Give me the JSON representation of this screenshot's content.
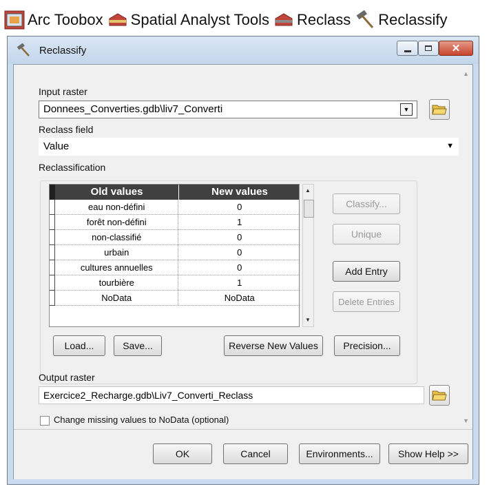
{
  "breadcrumb": {
    "items": [
      {
        "label": "Arc Toobox",
        "icon": "toolbox-icon"
      },
      {
        "label": "Spatial Analyst Tools",
        "icon": "toolset-icon"
      },
      {
        "label": "Reclass",
        "icon": "toolset-icon"
      },
      {
        "label": "Reclassify",
        "icon": "hammer-icon"
      }
    ]
  },
  "window": {
    "title": "Reclassify",
    "controls": {
      "minimize": "minimize",
      "maximize": "maximize",
      "close": "close"
    }
  },
  "form": {
    "input_raster_label": "Input raster",
    "input_raster_value": "Donnees_Converties.gdb\\liv7_Converti",
    "reclass_field_label": "Reclass field",
    "reclass_field_value": "Value",
    "reclassification_label": "Reclassification",
    "output_raster_label": "Output raster",
    "output_raster_value": "Exercice2_Recharge.gdb\\Liv7_Converti_Reclass",
    "missing_checkbox_label": "Change missing values to NoData (optional)",
    "missing_checkbox_checked": false
  },
  "reclass_table": {
    "headers": [
      "Old values",
      "New values"
    ],
    "rows": [
      [
        "eau non-défini",
        "0"
      ],
      [
        "forêt non-défini",
        "1"
      ],
      [
        "non-classifié",
        "0"
      ],
      [
        "urbain",
        "0"
      ],
      [
        "cultures annuelles",
        "0"
      ],
      [
        "tourbière",
        "1"
      ],
      [
        "NoData",
        "NoData"
      ]
    ]
  },
  "buttons": {
    "classify": "Classify...",
    "unique": "Unique",
    "add_entry": "Add Entry",
    "delete_entries": "Delete Entries",
    "load": "Load...",
    "save": "Save...",
    "reverse": "Reverse New Values",
    "precision": "Precision...",
    "ok": "OK",
    "cancel": "Cancel",
    "environments": "Environments...",
    "show_help": "Show Help >>"
  }
}
